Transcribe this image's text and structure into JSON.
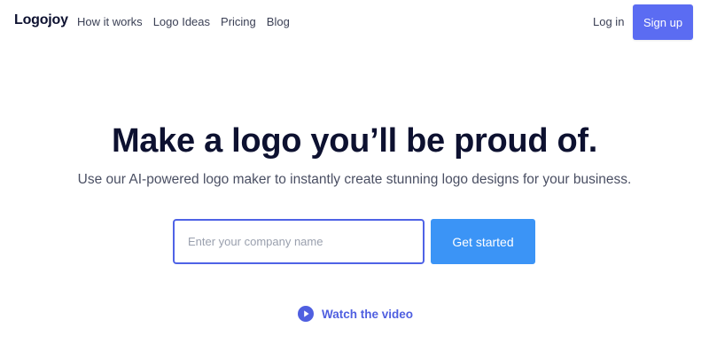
{
  "header": {
    "logo": "Logojoy",
    "nav": [
      "How it works",
      "Logo Ideas",
      "Pricing",
      "Blog"
    ],
    "login_label": "Log in",
    "signup_label": "Sign up"
  },
  "hero": {
    "headline": "Make a logo you’ll be proud of.",
    "subheadline": "Use our AI-powered logo maker to instantly create stunning logo designs for your business.",
    "company_input": {
      "placeholder": "Enter your company name",
      "value": ""
    },
    "cta_label": "Get started",
    "video_link_label": "Watch the video",
    "video_icon": "play-circle-icon"
  },
  "colors": {
    "signup_button": "#5b6cf2",
    "cta_button": "#3b94f6",
    "input_border": "#4f63e6",
    "video_link": "#4f5fe0",
    "headline_text": "#0d1130"
  }
}
